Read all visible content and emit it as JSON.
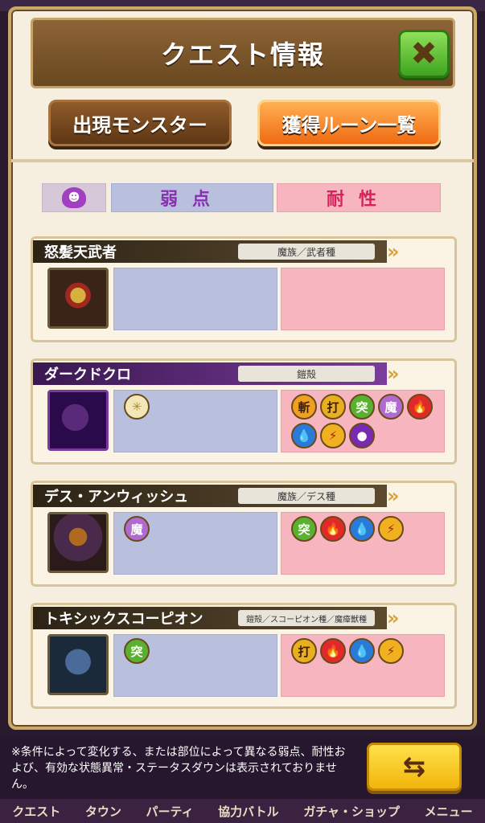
{
  "header": {
    "title": "クエスト情報",
    "close_label": "✖"
  },
  "tabs": [
    {
      "label": "出現モンスター"
    },
    {
      "label": "獲得ルーン一覧"
    }
  ],
  "legend": {
    "weak": "弱点",
    "resist": "耐性"
  },
  "monsters": [
    {
      "name": "怒髪天武者",
      "type": "魔族／武者種",
      "weak": [],
      "resist": []
    },
    {
      "name": "ダークドクロ",
      "type": "鎧殻",
      "weak": [
        "light"
      ],
      "resist": [
        "斬",
        "打",
        "突",
        "魔",
        "fire",
        "water",
        "thunder",
        "dark"
      ]
    },
    {
      "name": "デス・アンウィッシュ",
      "type": "魔族／デス種",
      "weak": [
        "魔"
      ],
      "resist": [
        "突",
        "fire",
        "water",
        "thunder"
      ]
    },
    {
      "name": "トキシックスコーピオン",
      "type": "鎧殻／スコーピオン種／魔瘴獣種",
      "weak": [
        "突"
      ],
      "resist": [
        "打",
        "fire",
        "water",
        "thunder"
      ]
    }
  ],
  "footer": {
    "note": "※条件によって変化する、または部位によって異なる弱点、耐性および、有効な状態異常・ステータスダウンは表示されておりません。",
    "swap_label": "⇆"
  },
  "nav": [
    "クエスト",
    "タウン",
    "パーティ",
    "協力バトル",
    "ガチャ・ショップ",
    "メニュー"
  ]
}
